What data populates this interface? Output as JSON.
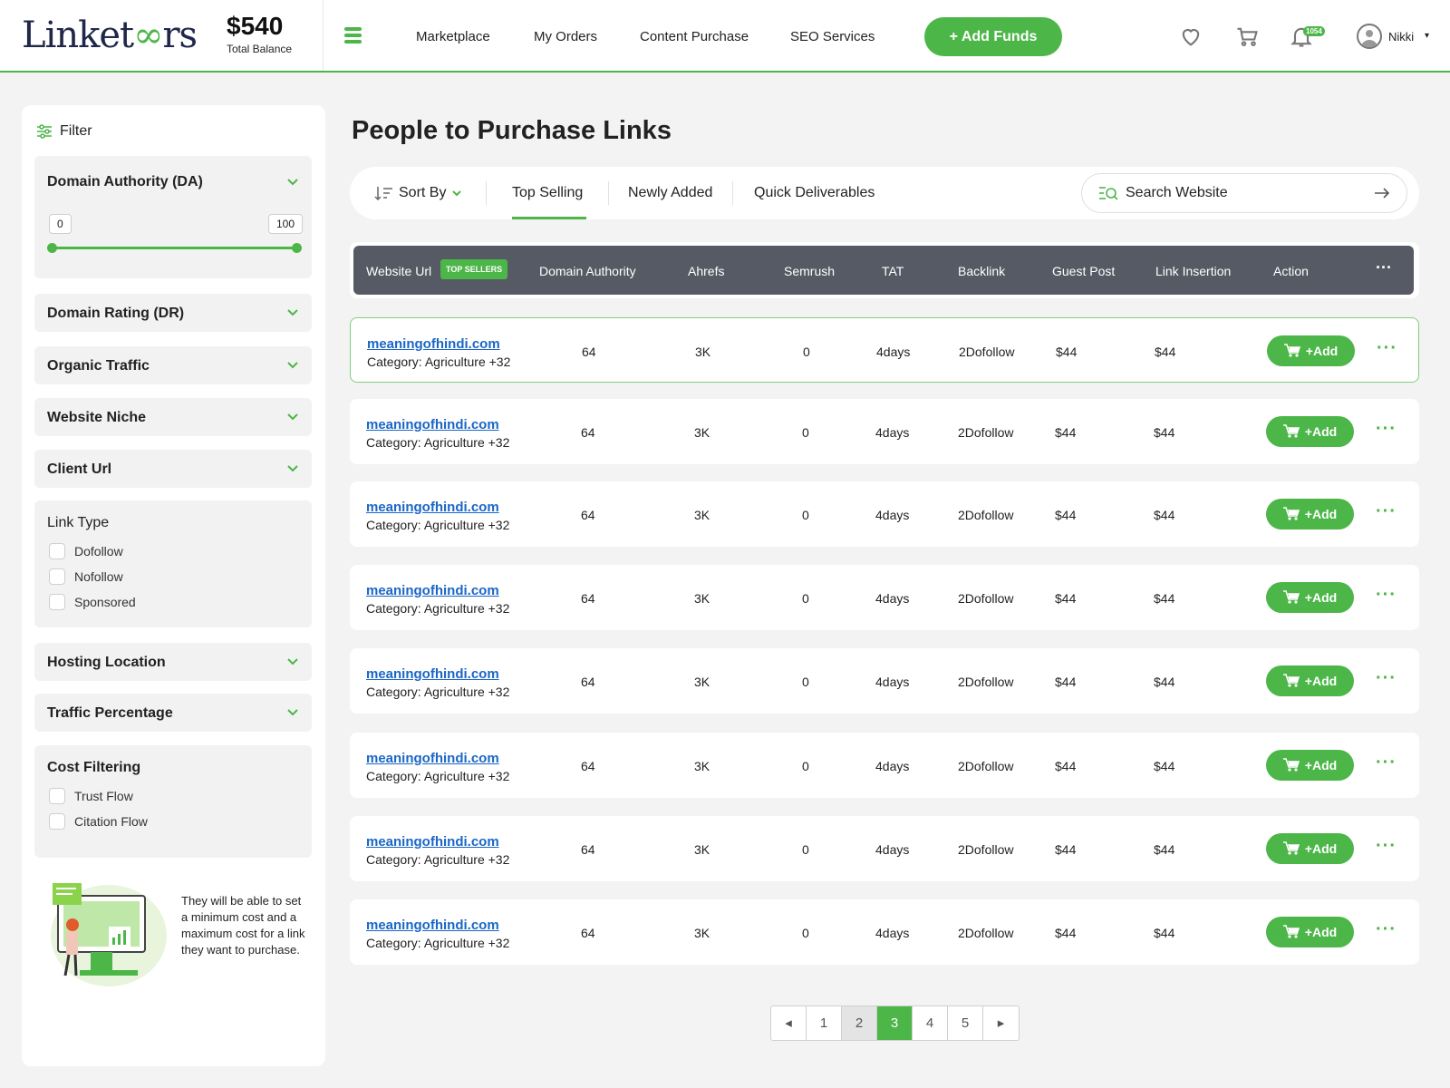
{
  "header": {
    "logo_text": "Linketeers",
    "balance_amount": "$540",
    "balance_label": "Total Balance",
    "nav": [
      "Marketplace",
      "My Orders",
      "Content Purchase",
      "SEO Services"
    ],
    "add_funds_label": "+ Add Funds",
    "notification_count": "1054",
    "username": "Nikki",
    "icons": [
      "heart-icon",
      "cart-icon",
      "bell-icon",
      "user-avatar-icon"
    ]
  },
  "sidebar": {
    "filter_label": "Filter",
    "domain_authority": {
      "title": "Domain Authority (DA)",
      "min": "0",
      "max": "100"
    },
    "collapsed_filters": [
      "Domain Rating (DR)",
      "Organic Traffic",
      "Website Niche",
      "Client Url"
    ],
    "link_type": {
      "title": "Link Type",
      "options": [
        "Dofollow",
        "Nofollow",
        "Sponsored"
      ]
    },
    "collapsed_filters_2": [
      "Hosting Location",
      "Traffic Percentage"
    ],
    "cost_filtering": {
      "title": "Cost Filtering",
      "options": [
        "Trust Flow",
        "Citation Flow"
      ]
    },
    "promo_text": "They will be able to set a minimum cost and a maximum cost for a link they want to purchase."
  },
  "main": {
    "page_title": "People to Purchase Links",
    "sort_label": "Sort By",
    "tabs": [
      "Top Selling",
      "Newly Added",
      "Quick Deliverables"
    ],
    "active_tab": "Top Selling",
    "search_placeholder": "Search Website",
    "columns": [
      "Website Url",
      "Domain Authority",
      "Ahrefs",
      "Semrush",
      "TAT",
      "Backlink",
      "Guest Post",
      "Link Insertion",
      "Action"
    ],
    "top_sellers_badge": "TOP SELLERS",
    "add_label": "+Add",
    "rows": [
      {
        "url": "meaningofhindi.com",
        "category": "Category: Agriculture +32",
        "da": "64",
        "ahrefs": "3K",
        "semrush": "0",
        "tat": "4days",
        "backlink": "2Dofollow",
        "guest_post": "$44",
        "link_insertion": "$44"
      },
      {
        "url": "meaningofhindi.com",
        "category": "Category: Agriculture +32",
        "da": "64",
        "ahrefs": "3K",
        "semrush": "0",
        "tat": "4days",
        "backlink": "2Dofollow",
        "guest_post": "$44",
        "link_insertion": "$44"
      },
      {
        "url": "meaningofhindi.com",
        "category": "Category: Agriculture +32",
        "da": "64",
        "ahrefs": "3K",
        "semrush": "0",
        "tat": "4days",
        "backlink": "2Dofollow",
        "guest_post": "$44",
        "link_insertion": "$44"
      },
      {
        "url": "meaningofhindi.com",
        "category": "Category: Agriculture +32",
        "da": "64",
        "ahrefs": "3K",
        "semrush": "0",
        "tat": "4days",
        "backlink": "2Dofollow",
        "guest_post": "$44",
        "link_insertion": "$44"
      },
      {
        "url": "meaningofhindi.com",
        "category": "Category: Agriculture +32",
        "da": "64",
        "ahrefs": "3K",
        "semrush": "0",
        "tat": "4days",
        "backlink": "2Dofollow",
        "guest_post": "$44",
        "link_insertion": "$44"
      },
      {
        "url": "meaningofhindi.com",
        "category": "Category: Agriculture +32",
        "da": "64",
        "ahrefs": "3K",
        "semrush": "0",
        "tat": "4days",
        "backlink": "2Dofollow",
        "guest_post": "$44",
        "link_insertion": "$44"
      },
      {
        "url": "meaningofhindi.com",
        "category": "Category: Agriculture +32",
        "da": "64",
        "ahrefs": "3K",
        "semrush": "0",
        "tat": "4days",
        "backlink": "2Dofollow",
        "guest_post": "$44",
        "link_insertion": "$44"
      },
      {
        "url": "meaningofhindi.com",
        "category": "Category: Agriculture +32",
        "da": "64",
        "ahrefs": "3K",
        "semrush": "0",
        "tat": "4days",
        "backlink": "2Dofollow",
        "guest_post": "$44",
        "link_insertion": "$44"
      }
    ],
    "pagination": {
      "pages": [
        "1",
        "2",
        "3",
        "4",
        "5"
      ],
      "current": "3"
    }
  },
  "colors": {
    "accent": "#4cb648",
    "header_dark": "#565a64",
    "link": "#1a66c7"
  }
}
